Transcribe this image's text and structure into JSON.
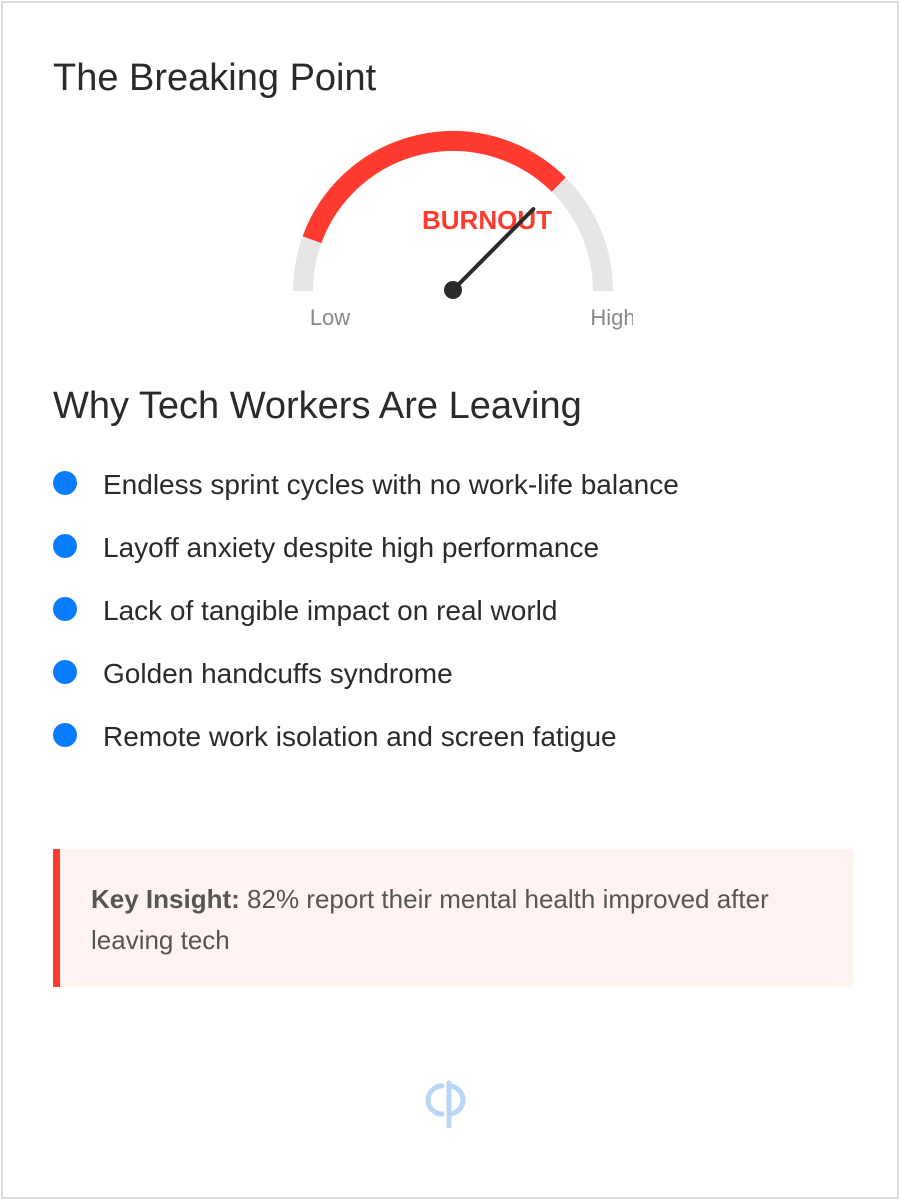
{
  "heading": "The Breaking Point",
  "gauge": {
    "status_label": "BURNOUT",
    "min_label": "Low",
    "max_label": "High",
    "level": 0.82,
    "colors": {
      "fill": "#ff3b30",
      "track": "#e6e6e6",
      "needle": "#2a2a2a"
    }
  },
  "reasons_section": {
    "heading": "Why Tech Workers Are Leaving",
    "bullet_color": "#0a7cff",
    "items": [
      "Endless sprint cycles with no work-life balance",
      "Layoff anxiety despite high performance",
      "Lack of tangible impact on real world",
      "Golden handcuffs syndrome",
      "Remote work isolation and screen fatigue"
    ]
  },
  "insight": {
    "label": "Key Insight:",
    "text": "82% report their mental health improved after leaving tech",
    "accent_color": "#ff3b30"
  },
  "footer": {
    "logo_icon": "brand-logo-icon"
  }
}
